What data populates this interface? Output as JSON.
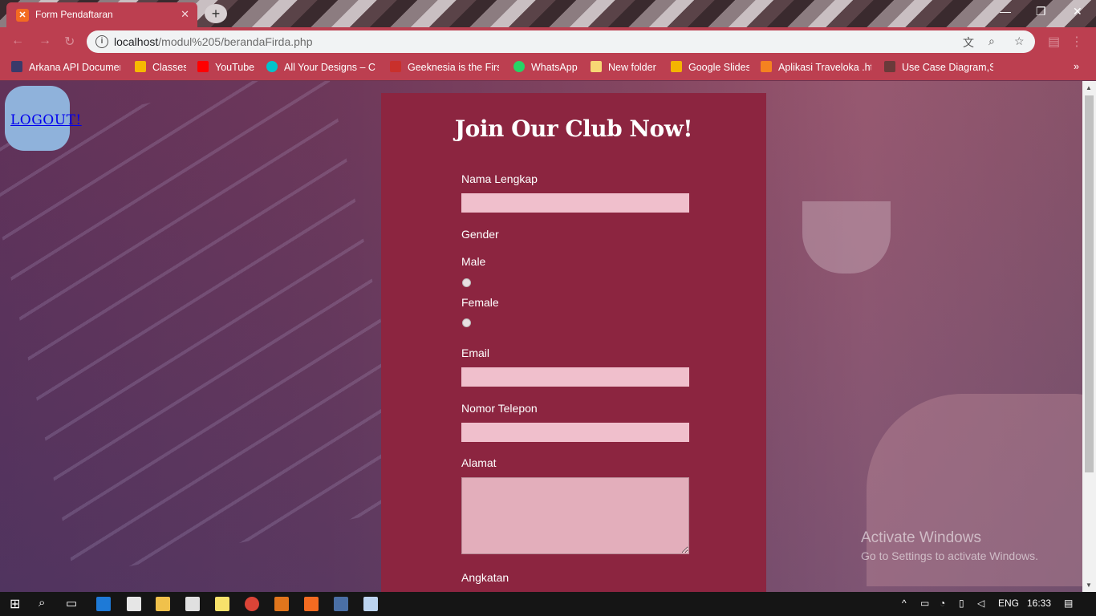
{
  "browser": {
    "tab_title": "Form Pendaftaran",
    "tab_close": "✕",
    "new_tab": "+",
    "url_host": "localhost",
    "url_path": "/modul%205/berandaFirda.php",
    "window_controls": [
      "—",
      "❐",
      "✕"
    ]
  },
  "bookmarks": [
    {
      "label": "Arkana API Documen",
      "color": "#3a3a6a"
    },
    {
      "label": "Classes",
      "color": "#f6b900"
    },
    {
      "label": "YouTube",
      "color": "#ff0000"
    },
    {
      "label": "All Your Designs – Ca",
      "color": "#00c4cc"
    },
    {
      "label": "Geeknesia is the First",
      "color": "#c9302c"
    },
    {
      "label": "WhatsApp",
      "color": "#25d366"
    },
    {
      "label": "New folder",
      "color": "#f7d774"
    },
    {
      "label": "Google Slides",
      "color": "#f4b400"
    },
    {
      "label": "Aplikasi Traveloka .htr",
      "color": "#f58220"
    },
    {
      "label": "Use Case Diagram,Sk",
      "color": "#6a3a3a"
    }
  ],
  "page": {
    "logout_label": "LOGOUT!",
    "form_title": "Join Our Club Now!",
    "fields": {
      "nama_label": "Nama Lengkap",
      "nama_value": "",
      "gender_label": "Gender",
      "male_label": "Male",
      "female_label": "Female",
      "email_label": "Email",
      "email_value": "",
      "telepon_label": "Nomor Telepon",
      "telepon_value": "",
      "alamat_label": "Alamat",
      "alamat_value": "",
      "angkatan_label": "Angkatan"
    },
    "watermark_title": "Activate Windows",
    "watermark_sub": "Go to Settings to activate Windows."
  },
  "taskbar": {
    "language": "ENG",
    "time": "16:33"
  }
}
